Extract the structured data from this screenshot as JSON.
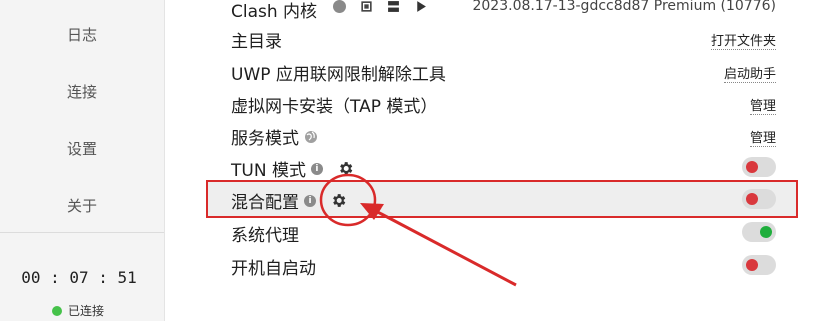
{
  "sidebar": {
    "items": [
      {
        "label": "日志"
      },
      {
        "label": "连接"
      },
      {
        "label": "设置"
      },
      {
        "label": "关于"
      }
    ],
    "timer": "00 : 07 : 51",
    "status": "已连接",
    "status_color": "#45c24a"
  },
  "settings": {
    "clash_core": {
      "label": "Clash 内核",
      "value": "2023.08.17-13-gdcc8d87 Premium (10776)"
    },
    "home_dir": {
      "label": "主目录",
      "action": "打开文件夹"
    },
    "uwp": {
      "label": "UWP 应用联网限制解除工具",
      "action": "启动助手"
    },
    "tap": {
      "label": "虚拟网卡安装（TAP 模式）",
      "action": "管理"
    },
    "service": {
      "label": "服务模式",
      "action": "管理"
    },
    "tun": {
      "label": "TUN 模式",
      "enabled": false
    },
    "mixin": {
      "label": "混合配置",
      "enabled": false
    },
    "system_proxy": {
      "label": "系统代理",
      "enabled": true
    },
    "autostart": {
      "label": "开机自启动",
      "enabled": false
    }
  },
  "colors": {
    "toggle_off": "#d9383d",
    "toggle_on": "#1fae3c",
    "annotation": "#d92a2a"
  }
}
